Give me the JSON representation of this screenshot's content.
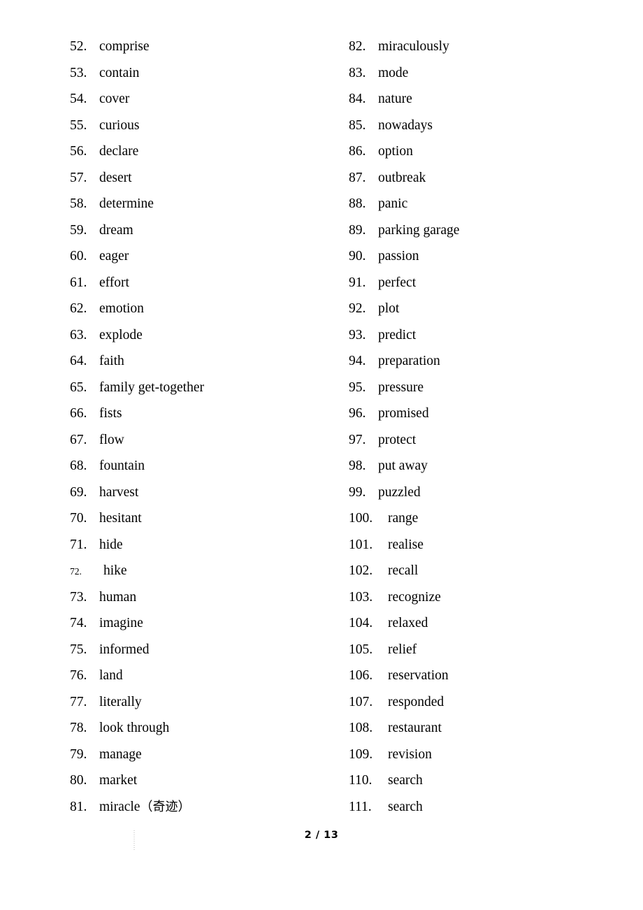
{
  "document": {
    "columns": [
      {
        "name": "left",
        "items": [
          {
            "num": "52.",
            "word": "comprise"
          },
          {
            "num": "53.",
            "word": "contain"
          },
          {
            "num": "54.",
            "word": "cover"
          },
          {
            "num": "55.",
            "word": "curious"
          },
          {
            "num": "56.",
            "word": "declare"
          },
          {
            "num": "57.",
            "word": "desert"
          },
          {
            "num": "58.",
            "word": "determine"
          },
          {
            "num": "59.",
            "word": "dream"
          },
          {
            "num": "60.",
            "word": "eager"
          },
          {
            "num": "61.",
            "word": "effort"
          },
          {
            "num": "62.",
            "word": "emotion"
          },
          {
            "num": "63.",
            "word": "explode"
          },
          {
            "num": "64.",
            "word": "faith"
          },
          {
            "num": "65.",
            "word": "family get-together"
          },
          {
            "num": "66.",
            "word": "fists"
          },
          {
            "num": "67.",
            "word": "flow"
          },
          {
            "num": "68.",
            "word": "fountain"
          },
          {
            "num": "69.",
            "word": "harvest"
          },
          {
            "num": "70.",
            "word": "hesitant"
          },
          {
            "num": "71.",
            "word": "hide"
          },
          {
            "num": "72.",
            "word": "hike",
            "style": "small-num"
          },
          {
            "num": "73.",
            "word": "human"
          },
          {
            "num": "74.",
            "word": "imagine"
          },
          {
            "num": "75.",
            "word": "informed"
          },
          {
            "num": "76.",
            "word": "land"
          },
          {
            "num": "77.",
            "word": "literally"
          },
          {
            "num": "78.",
            "word": "look through"
          },
          {
            "num": "79.",
            "word": "manage"
          },
          {
            "num": "80.",
            "word": "market"
          },
          {
            "num": "81.",
            "word": "miracle（奇迹）"
          }
        ]
      },
      {
        "name": "right",
        "items": [
          {
            "num": "82.",
            "word": "miraculously"
          },
          {
            "num": "83.",
            "word": "mode"
          },
          {
            "num": "84.",
            "word": "nature"
          },
          {
            "num": "85.",
            "word": "nowadays"
          },
          {
            "num": "86.",
            "word": "option"
          },
          {
            "num": "87.",
            "word": "outbreak"
          },
          {
            "num": "88.",
            "word": "panic"
          },
          {
            "num": "89.",
            "word": "parking garage"
          },
          {
            "num": "90.",
            "word": "passion"
          },
          {
            "num": "91.",
            "word": "perfect"
          },
          {
            "num": "92.",
            "word": "plot"
          },
          {
            "num": "93.",
            "word": "predict"
          },
          {
            "num": "94.",
            "word": "preparation"
          },
          {
            "num": "95.",
            "word": "pressure"
          },
          {
            "num": "96.",
            "word": "promised"
          },
          {
            "num": "97.",
            "word": "protect"
          },
          {
            "num": "98.",
            "word": "put away"
          },
          {
            "num": "99.",
            "word": "puzzled"
          },
          {
            "num": "100.",
            "word": "range",
            "style": "wide"
          },
          {
            "num": "101.",
            "word": "realise",
            "style": "wide"
          },
          {
            "num": "102.",
            "word": "recall",
            "style": "wide"
          },
          {
            "num": "103.",
            "word": "recognize",
            "style": "wide"
          },
          {
            "num": "104.",
            "word": "relaxed",
            "style": "wide"
          },
          {
            "num": "105.",
            "word": "relief",
            "style": "wide"
          },
          {
            "num": "106.",
            "word": "reservation",
            "style": "wide"
          },
          {
            "num": "107.",
            "word": "responded",
            "style": "wide"
          },
          {
            "num": "108.",
            "word": "restaurant",
            "style": "wide"
          },
          {
            "num": "109.",
            "word": "revision",
            "style": "wide"
          },
          {
            "num": "110.",
            "word": "search",
            "style": "wide"
          },
          {
            "num": "111.",
            "word": "search",
            "style": "wide"
          }
        ]
      }
    ],
    "footer": {
      "page_label": "2 / 13",
      "current_page": "2",
      "total_pages": "13"
    },
    "colors": {
      "page_background": "#ffffff",
      "text": "#000000",
      "artifact": "#cfcfcf"
    }
  }
}
